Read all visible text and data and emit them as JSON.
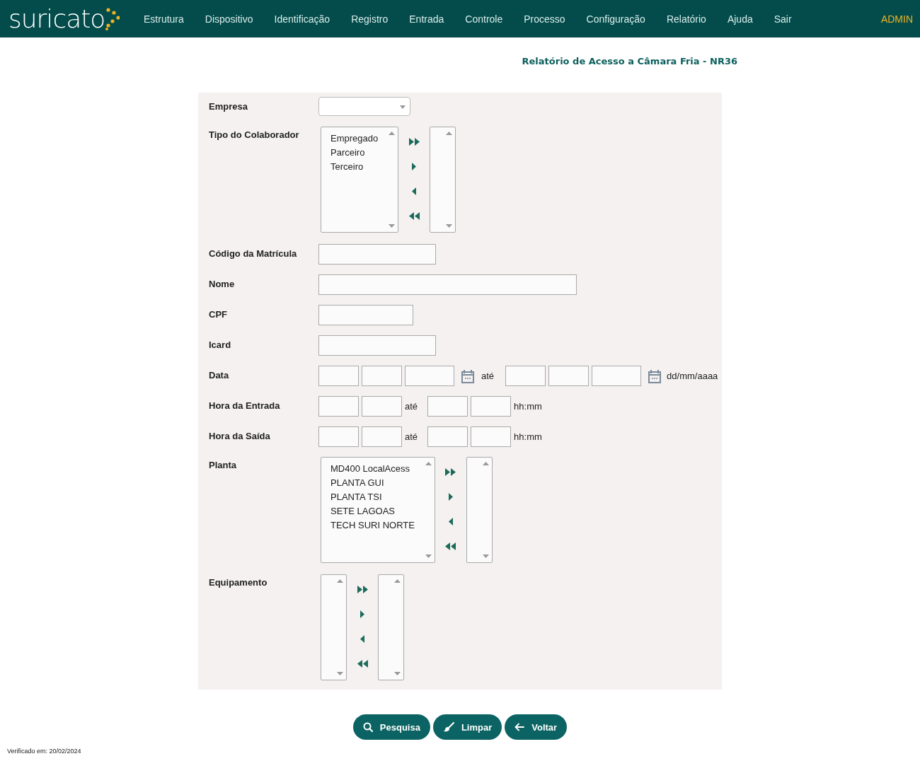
{
  "nav": {
    "logo": "suricato",
    "items": [
      "Estrutura",
      "Dispositivo",
      "Identificação",
      "Registro",
      "Entrada",
      "Controle",
      "Processo",
      "Configuração",
      "Relatório",
      "Ajuda",
      "Sair"
    ],
    "user": "ADMIN"
  },
  "page_title": "Relatório de Acesso a Câmara Fria - NR36",
  "form": {
    "rows": [
      {
        "kind": "select",
        "label": "Empresa"
      },
      {
        "kind": "transfer",
        "label": "Tipo do Colaborador",
        "available": [
          "Empregado",
          "Parceiro",
          "Terceiro"
        ]
      },
      {
        "kind": "text",
        "label": "Código da Matrícula"
      },
      {
        "kind": "text",
        "label": "Nome"
      },
      {
        "kind": "text",
        "label": "CPF"
      },
      {
        "kind": "text",
        "label": "Icard"
      },
      {
        "kind": "date_range",
        "label": "Data",
        "separator": "até",
        "hint": "dd/mm/aaaa"
      },
      {
        "kind": "time_range",
        "label": "Hora da Entrada",
        "separator": "até",
        "hint": "hh:mm"
      },
      {
        "kind": "time_range",
        "label": "Hora da Saída",
        "separator": "até",
        "hint": "hh:mm"
      },
      {
        "kind": "transfer",
        "label": "Planta",
        "available": [
          "MD400 LocalAcess",
          "PLANTA GUI",
          "PLANTA TSI",
          "SETE LAGOAS",
          "TECH SURI NORTE"
        ]
      },
      {
        "kind": "transfer",
        "label": "Equipamento"
      }
    ]
  },
  "buttons": [
    {
      "kind": "search",
      "label": "Pesquisa"
    },
    {
      "kind": "clear",
      "label": "Limpar"
    },
    {
      "kind": "back",
      "label": "Voltar"
    }
  ],
  "footer": "Verificado em: 20/02/2024"
}
